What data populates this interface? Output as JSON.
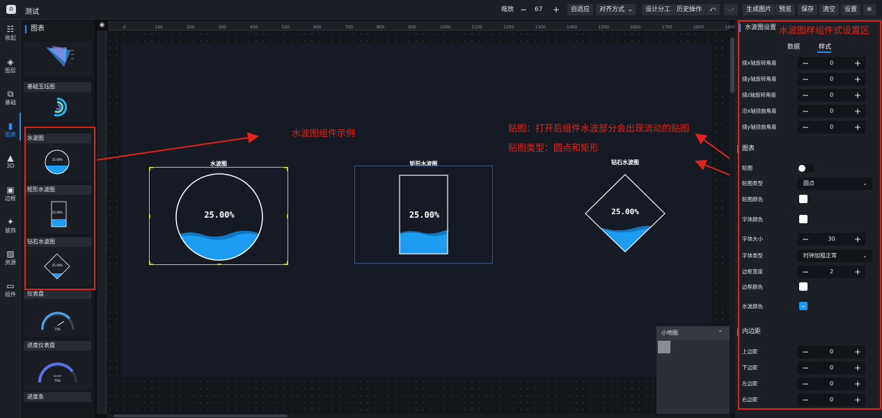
{
  "app": {
    "title": "测试"
  },
  "toolbar": {
    "zoom_label": "缩放",
    "zoom_value": "67",
    "minus": "−",
    "plus": "+",
    "fit": "自适应",
    "align": "对齐方式",
    "design_split": "设计分工",
    "history": "历史操作",
    "undo": "⤺",
    "redo": "⤻",
    "gen_image": "生成图片",
    "preview": "预览",
    "save": "保存",
    "clear": "清空",
    "settings": "设置",
    "menu": "≡"
  },
  "nav": [
    {
      "icon": "☷",
      "label": "收起"
    },
    {
      "icon": "◈",
      "label": "图层"
    },
    {
      "icon": "⧉",
      "label": "基础"
    },
    {
      "icon": "▮",
      "label": "图表"
    },
    {
      "icon": "▲",
      "label": "3D"
    },
    {
      "icon": "▣",
      "label": "边框"
    },
    {
      "icon": "✦",
      "label": "装饰"
    },
    {
      "icon": "▨",
      "label": "资源"
    },
    {
      "icon": "▭",
      "label": "组件"
    }
  ],
  "components": {
    "header": "图表",
    "cards": [
      {
        "title": ""
      },
      {
        "title": "基础玉珏图"
      },
      {
        "title": "水波图",
        "percent": "25.00%"
      },
      {
        "title": "矩形水波图",
        "percent": "25.00%"
      },
      {
        "title": "钻石水波图",
        "percent": "25.00%"
      },
      {
        "title": "仪表盘",
        "gauge": "75%"
      },
      {
        "title": "进度仪表盘",
        "gauge": "75%",
        "caption": "SHARE"
      },
      {
        "title": "进度条"
      }
    ]
  },
  "ruler": {
    "ticks": [
      "0",
      "100",
      "200",
      "300",
      "400",
      "500",
      "600",
      "700",
      "800",
      "900",
      "1000",
      "1100",
      "1200",
      "1300",
      "1400",
      "1500",
      "1600",
      "1700",
      "1800",
      "1900"
    ]
  },
  "canvas": {
    "widgets": [
      {
        "title": "水波图",
        "percent": "25.00%"
      },
      {
        "title": "矩形水波图",
        "percent": "25.00%"
      },
      {
        "title": "钻石水波图",
        "percent": "25.00%"
      }
    ],
    "annotations": {
      "example": "水波图组件示例",
      "texture": "贴图：打开后组件水波部分会出现流动的贴图",
      "texture_type": "贴图类型：圆点和矩形",
      "style_area": "水波图样组件式设置区"
    },
    "minimap": {
      "title": "小地图",
      "toggle": "⌃"
    }
  },
  "panel": {
    "title": "水波图设置",
    "tabs": {
      "data": "数据",
      "style": "样式"
    },
    "rotations": [
      {
        "label": "绕x轴旋转角度",
        "value": "0"
      },
      {
        "label": "绕y轴旋转角度",
        "value": "0"
      },
      {
        "label": "绕z轴旋转角度",
        "value": "0"
      },
      {
        "label": "沿x轴扭曲角度",
        "value": "0"
      },
      {
        "label": "绕y轴扭曲角度",
        "value": "0"
      }
    ],
    "chart_section": "图表",
    "texture": {
      "label": "贴图",
      "on": false
    },
    "texture_type": {
      "label": "贴图类型",
      "value": "圆点"
    },
    "texture_color": {
      "label": "贴图颜色",
      "color": "#ffffff"
    },
    "font_color": {
      "label": "字体颜色",
      "color": "#ffffff"
    },
    "font_size": {
      "label": "字体大小",
      "value": "30"
    },
    "font_type": {
      "label": "字体类型",
      "value": "时钟加粗正常"
    },
    "border_width": {
      "label": "边框宽度",
      "value": "2"
    },
    "border_color": {
      "label": "边框颜色",
      "color": "#ffffff"
    },
    "wave_color": {
      "label": "水波颜色",
      "color": "#1e9cf2"
    },
    "padding_section": "内边距",
    "padding": [
      {
        "label": "上边距",
        "value": "0"
      },
      {
        "label": "下边距",
        "value": "0"
      },
      {
        "label": "左边距",
        "value": "0"
      },
      {
        "label": "右边距",
        "value": "0"
      }
    ]
  },
  "colors": {
    "accent": "#2f8df7",
    "annotation": "#e3231b",
    "wave": "#1e9cf2",
    "wave_dark": "#1378c4"
  }
}
